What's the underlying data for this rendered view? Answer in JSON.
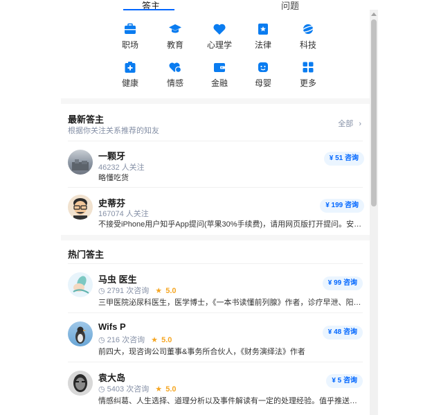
{
  "tabs": [
    {
      "label": "答主",
      "active": true
    },
    {
      "label": "问题",
      "active": false
    }
  ],
  "categories": [
    {
      "label": "职场",
      "icon": "briefcase-icon"
    },
    {
      "label": "教育",
      "icon": "graduation-cap-icon"
    },
    {
      "label": "心理学",
      "icon": "heart-icon"
    },
    {
      "label": "法律",
      "icon": "law-book-icon"
    },
    {
      "label": "科技",
      "icon": "planet-icon"
    },
    {
      "label": "健康",
      "icon": "medical-kit-icon"
    },
    {
      "label": "情感",
      "icon": "emotion-icon"
    },
    {
      "label": "金融",
      "icon": "wallet-icon"
    },
    {
      "label": "母婴",
      "icon": "baby-icon"
    },
    {
      "label": "更多",
      "icon": "grid-icon"
    }
  ],
  "latest": {
    "title": "最新答主",
    "subtitle": "根据你关注关系推荐的知友",
    "more_label": "全部",
    "items": [
      {
        "name": "一颗牙",
        "followers": "46232 人关注",
        "desc": "略懂吃货",
        "price": "¥ 51 咨询"
      },
      {
        "name": "史蒂芬",
        "followers": "167074 人关注",
        "desc": "不接受iPhone用户知乎App提问(苹果30%手续费)，请用网页版打开提问。安卓用户…",
        "price": "¥ 199 咨询"
      }
    ]
  },
  "hot": {
    "title": "热门答主",
    "items": [
      {
        "name": "马虫 医生",
        "consults": "2791 次咨询",
        "rating": "5.0",
        "desc": "三甲医院泌尿科医生，医学博士，《一本书读懂前列腺》作者，诊疗早泄、阳痿、前…",
        "price": "¥ 99 咨询"
      },
      {
        "name": "Wifs P",
        "consults": "216 次咨询",
        "rating": "5.0",
        "desc": "前四大，现咨询公司董事&事务所合伙人，《财务演绎法》作者",
        "price": "¥ 48 咨询"
      },
      {
        "name": "袁大岛",
        "consults": "5403 次咨询",
        "rating": "5.0",
        "desc": "情感纠葛、人生选择、道理分析以及事件解读有一定的处理经验。值乎推送有一定的…",
        "price": "¥ 5 咨询"
      }
    ]
  },
  "colors": {
    "accent": "#0066ff",
    "star": "#f5a623",
    "muted": "#8590a6"
  }
}
